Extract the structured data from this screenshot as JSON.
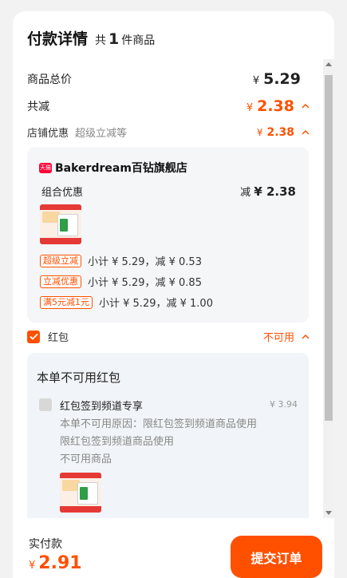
{
  "header": {
    "title": "付款详情",
    "count_prefix": "共",
    "count": "1",
    "count_suffix": "件商品"
  },
  "summary": {
    "total_label": "商品总价",
    "total_currency": "¥",
    "total_value": "5.29",
    "reduce_label": "共减",
    "reduce_currency": "¥",
    "reduce_value": "2.38",
    "store_discount_label": "店铺优惠",
    "store_discount_sub": "超级立减等",
    "store_discount_currency": "¥",
    "store_discount_value": "2.38"
  },
  "store": {
    "badge_text": "天猫",
    "name": "Bakerdream百钻旗舰店",
    "combo_label": "组合优惠",
    "combo_prefix": "减",
    "combo_value": "¥ 2.38",
    "promos": [
      {
        "tag": "超级立减",
        "text": "小计 ¥ 5.29，减 ¥ 0.53"
      },
      {
        "tag": "立减优惠",
        "text": "小计 ¥ 5.29，减 ¥ 0.85"
      },
      {
        "tag": "满5元减1元",
        "text": "小计 ¥ 5.29，减 ¥ 1.00"
      }
    ]
  },
  "redpack": {
    "label": "红包",
    "status": "不可用",
    "box_title": "本单不可用红包",
    "item_name": "红包签到频道专享",
    "item_amount": "¥ 3.94",
    "reason_1": "本单不可用原因：限红包签到频道商品使用",
    "reason_2": "限红包签到频道商品使用",
    "reason_3": "不可用商品"
  },
  "footer": {
    "pay_label": "实付款",
    "pay_currency": "¥",
    "pay_value": "2.91",
    "submit_label": "提交订单"
  },
  "colors": {
    "accent": "#ff5000",
    "tmall_red": "#ff0036"
  }
}
